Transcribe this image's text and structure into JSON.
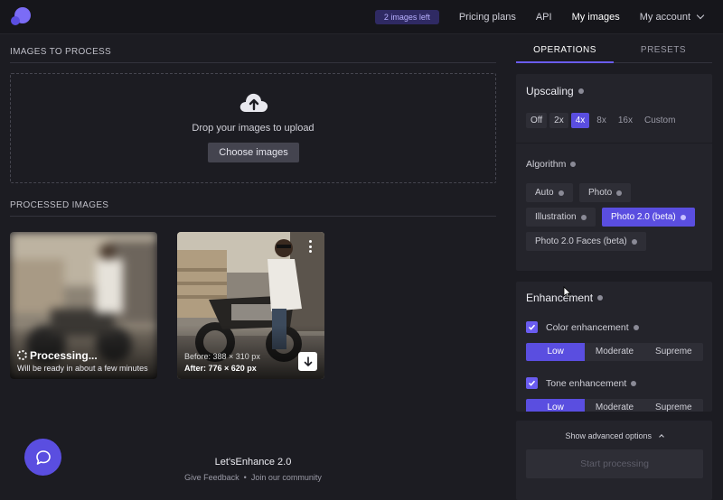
{
  "header": {
    "badge": "2 images left",
    "nav": [
      "Pricing plans",
      "API",
      "My images",
      "My account"
    ],
    "active_nav": "My images"
  },
  "left": {
    "upload_title": "IMAGES TO PROCESS",
    "drop_text": "Drop your images to upload",
    "choose_label": "Choose images",
    "processed_title": "PROCESSED IMAGES",
    "items": [
      {
        "status": "Processing...",
        "sub": "Will be ready in about a few minutes"
      },
      {
        "before": "Before: 388 × 310 px",
        "after": "After: 776 × 620 px"
      }
    ]
  },
  "footer": {
    "title": "Let'sEnhance 2.0",
    "link1": "Give Feedback",
    "sep": "•",
    "link2": "Join our community"
  },
  "tabs": {
    "operations": "OPERATIONS",
    "presets": "PRESETS",
    "active": "OPERATIONS"
  },
  "upscaling": {
    "title": "Upscaling",
    "options": [
      "Off",
      "2x",
      "4x",
      "8x",
      "16x",
      "Custom"
    ],
    "selected": "4x"
  },
  "algorithm": {
    "label": "Algorithm",
    "options": [
      "Auto",
      "Photo",
      "Illustration",
      "Photo 2.0 (beta)",
      "Photo 2.0 Faces (beta)"
    ],
    "selected": "Photo 2.0 (beta)"
  },
  "enhancement": {
    "title": "Enhancement",
    "color_label": "Color enhancement",
    "color_checked": true,
    "color_levels": [
      "Low",
      "Moderate",
      "Supreme"
    ],
    "color_selected": "Low",
    "tone_label": "Tone enhancement",
    "tone_checked": true,
    "tone_levels": [
      "Low",
      "Moderate",
      "Supreme"
    ],
    "tone_selected": "Low"
  },
  "actions": {
    "advanced": "Show advanced options",
    "start": "Start processing"
  },
  "colors": {
    "accent": "#5a4ee0",
    "bg": "#1c1c22",
    "panel": "#24242b"
  },
  "icons": [
    "logo-icon",
    "chevron-down-icon",
    "upload-cloud-icon",
    "spinner-icon",
    "download-icon",
    "more-icon",
    "info-icon",
    "check-icon",
    "chat-icon",
    "chevron-up-icon",
    "cursor-icon"
  ]
}
